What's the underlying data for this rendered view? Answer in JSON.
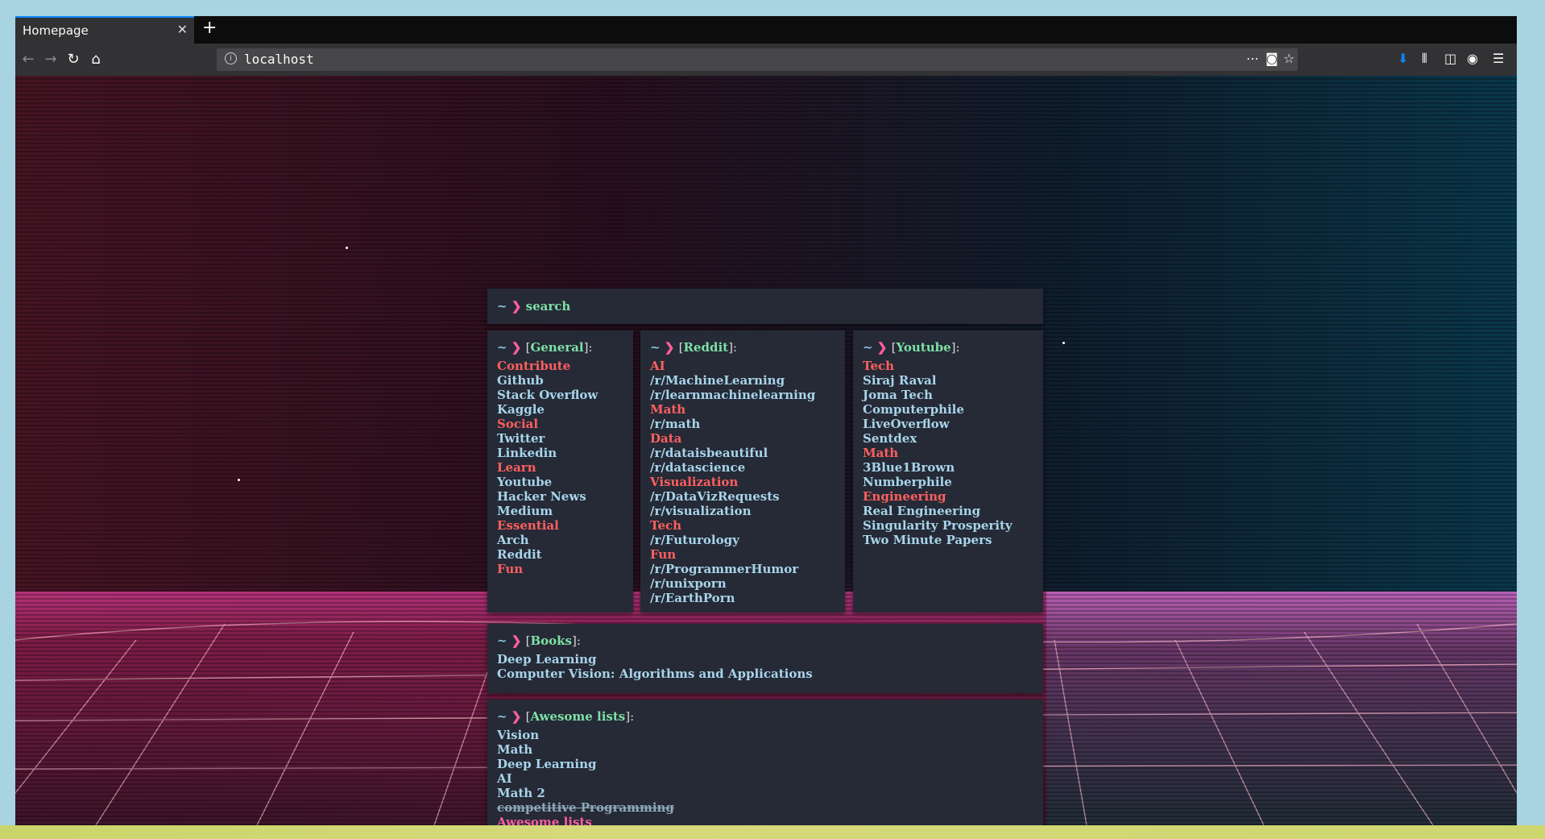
{
  "browser": {
    "tab_title": "Homepage",
    "tab_close": "✕",
    "new_tab": "+",
    "url": "localhost"
  },
  "icons": {
    "back": "arrow-left-icon",
    "forward": "arrow-right-icon",
    "reload": "reload-icon",
    "home": "home-icon",
    "info": "info-icon",
    "more": "more-icon",
    "pocket": "pocket-icon",
    "bookmark": "star-icon",
    "download": "download-icon",
    "library": "library-icon",
    "sidebar": "sidebar-icon",
    "account": "account-icon",
    "menu": "hamburger-icon"
  },
  "colors": {
    "panel_bg": "#252a36",
    "category": "#ff5f5f",
    "link": "#a8d4ea",
    "heading": "#7ee0a6",
    "prompt_arrow": "#ff5fa0",
    "tab_accent": "#0a84ff"
  },
  "prompt": {
    "tilde": "~",
    "arrow": "❯"
  },
  "search": {
    "label": "search"
  },
  "sections": {
    "general": {
      "name": "General",
      "items": [
        {
          "text": "Contribute",
          "type": "cat"
        },
        {
          "text": "Github",
          "type": "link"
        },
        {
          "text": "Stack Overflow",
          "type": "link"
        },
        {
          "text": "Kaggle",
          "type": "link"
        },
        {
          "text": "Social",
          "type": "cat"
        },
        {
          "text": "Twitter",
          "type": "link"
        },
        {
          "text": "Linkedin",
          "type": "link"
        },
        {
          "text": "Learn",
          "type": "cat"
        },
        {
          "text": "Youtube",
          "type": "link"
        },
        {
          "text": "Hacker News",
          "type": "link"
        },
        {
          "text": "Medium",
          "type": "link"
        },
        {
          "text": "Essential",
          "type": "cat"
        },
        {
          "text": "Arch",
          "type": "link"
        },
        {
          "text": "Reddit",
          "type": "link"
        },
        {
          "text": "Fun",
          "type": "cat"
        }
      ]
    },
    "reddit": {
      "name": "Reddit",
      "items": [
        {
          "text": "AI",
          "type": "cat"
        },
        {
          "text": "/r/MachineLearning",
          "type": "link"
        },
        {
          "text": "/r/learnmachinelearning",
          "type": "link"
        },
        {
          "text": "Math",
          "type": "cat"
        },
        {
          "text": "/r/math",
          "type": "link"
        },
        {
          "text": "Data",
          "type": "cat"
        },
        {
          "text": "/r/dataisbeautiful",
          "type": "link"
        },
        {
          "text": "/r/datascience",
          "type": "link"
        },
        {
          "text": "Visualization",
          "type": "cat"
        },
        {
          "text": "/r/DataVizRequests",
          "type": "link"
        },
        {
          "text": "/r/visualization",
          "type": "link"
        },
        {
          "text": "Tech",
          "type": "cat"
        },
        {
          "text": "/r/Futurology",
          "type": "link"
        },
        {
          "text": "Fun",
          "type": "cat"
        },
        {
          "text": "/r/ProgrammerHumor",
          "type": "link"
        },
        {
          "text": "/r/unixporn",
          "type": "link"
        },
        {
          "text": "/r/EarthPorn",
          "type": "link"
        }
      ]
    },
    "youtube": {
      "name": "Youtube",
      "items": [
        {
          "text": "Tech",
          "type": "cat"
        },
        {
          "text": "Siraj Raval",
          "type": "link"
        },
        {
          "text": "Joma Tech",
          "type": "link"
        },
        {
          "text": "Computerphile",
          "type": "link"
        },
        {
          "text": "LiveOverflow",
          "type": "link"
        },
        {
          "text": "Sentdex",
          "type": "link"
        },
        {
          "text": "Math",
          "type": "cat"
        },
        {
          "text": "3Blue1Brown",
          "type": "link"
        },
        {
          "text": "Numberphile",
          "type": "link"
        },
        {
          "text": "Engineering",
          "type": "cat"
        },
        {
          "text": "Real Engineering",
          "type": "link"
        },
        {
          "text": "Singularity Prosperity",
          "type": "link"
        },
        {
          "text": "Two Minute Papers",
          "type": "link"
        }
      ]
    },
    "books": {
      "name": "Books",
      "items": [
        {
          "text": "Deep Learning",
          "type": "link"
        },
        {
          "text": "Computer Vision: Algorithms and Applications",
          "type": "link"
        }
      ]
    },
    "awesome": {
      "name": "Awesome lists",
      "items": [
        {
          "text": "Vision",
          "type": "link"
        },
        {
          "text": "Math",
          "type": "link"
        },
        {
          "text": "Deep Learning",
          "type": "link"
        },
        {
          "text": "AI",
          "type": "link"
        },
        {
          "text": "Math 2",
          "type": "link"
        },
        {
          "text": "competitive Programming",
          "type": "strike"
        },
        {
          "text": "Awesome lists",
          "type": "pink"
        }
      ]
    }
  }
}
